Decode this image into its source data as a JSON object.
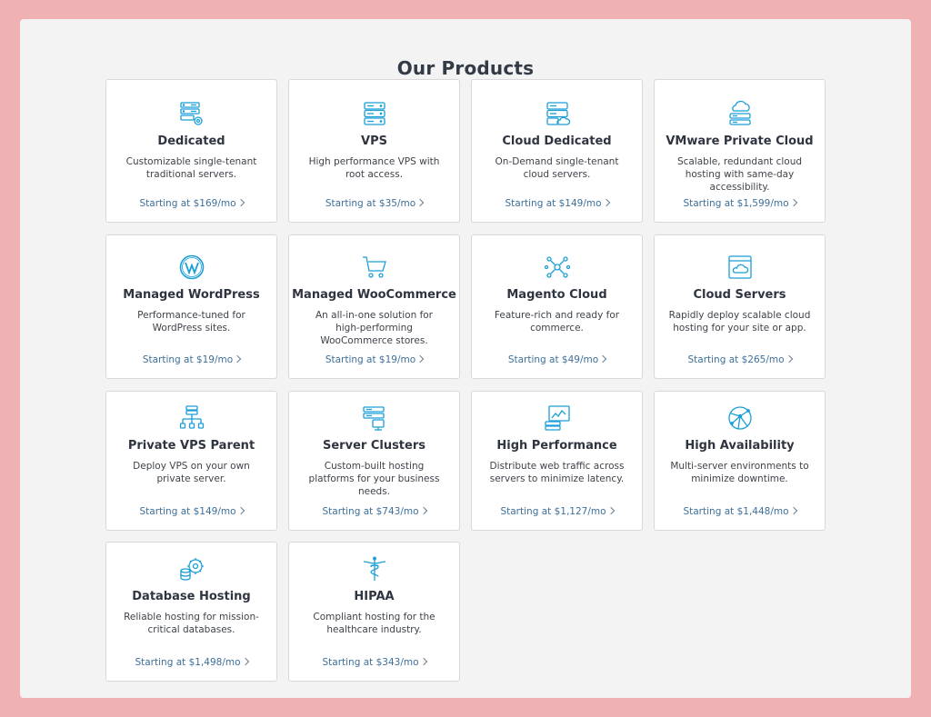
{
  "page": {
    "title": "Our Products"
  },
  "colors": {
    "accent": "#1b9fd6",
    "link": "#3d6f9a",
    "background": "#efb1b3"
  },
  "products": [
    {
      "name": "Dedicated",
      "desc": "Customizable single-tenant traditional servers.",
      "price": "Starting at $169/mo",
      "icon": "dedicated-server-icon"
    },
    {
      "name": "VPS",
      "desc": "High performance VPS with root access.",
      "price": "Starting at $35/mo",
      "icon": "server-stack-icon"
    },
    {
      "name": "Cloud Dedicated",
      "desc": "On-Demand single-tenant cloud servers.",
      "price": "Starting at $149/mo",
      "icon": "cloud-server-icon"
    },
    {
      "name": "VMware Private Cloud",
      "desc": "Scalable, redundant cloud hosting with same-day accessibility.",
      "price": "Starting at $1,599/mo",
      "icon": "cloud-stack-icon"
    },
    {
      "name": "Managed WordPress",
      "desc": "Performance-tuned for WordPress sites.",
      "price": "Starting at $19/mo",
      "icon": "wordpress-icon"
    },
    {
      "name": "Managed WooCommerce",
      "desc": "An all-in-one solution for high-performing WooCommerce stores.",
      "price": "Starting at $19/mo",
      "icon": "shopping-cart-icon"
    },
    {
      "name": "Magento Cloud",
      "desc": "Feature-rich and ready for commerce.",
      "price": "Starting at $49/mo",
      "icon": "magento-network-icon"
    },
    {
      "name": "Cloud Servers",
      "desc": "Rapidly deploy scalable cloud hosting for your site or app.",
      "price": "Starting at $265/mo",
      "icon": "cloud-window-icon"
    },
    {
      "name": "Private VPS Parent",
      "desc": "Deploy VPS on your own private server.",
      "price": "Starting at $149/mo",
      "icon": "server-tree-icon"
    },
    {
      "name": "Server Clusters",
      "desc": "Custom-built hosting platforms for your business needs.",
      "price": "Starting at $743/mo",
      "icon": "server-cluster-icon"
    },
    {
      "name": "High Performance",
      "desc": "Distribute web traffic across servers to minimize latency.",
      "price": "Starting at $1,127/mo",
      "icon": "performance-chart-icon"
    },
    {
      "name": "High Availability",
      "desc": "Multi-server environments to minimize downtime.",
      "price": "Starting at $1,448/mo",
      "icon": "globe-network-icon"
    },
    {
      "name": "Database Hosting",
      "desc": "Reliable hosting for mission-critical databases.",
      "price": "Starting at $1,498/mo",
      "icon": "database-gear-icon"
    },
    {
      "name": "HIPAA",
      "desc": "Compliant hosting for the healthcare industry.",
      "price": "Starting at $343/mo",
      "icon": "caduceus-icon"
    }
  ]
}
